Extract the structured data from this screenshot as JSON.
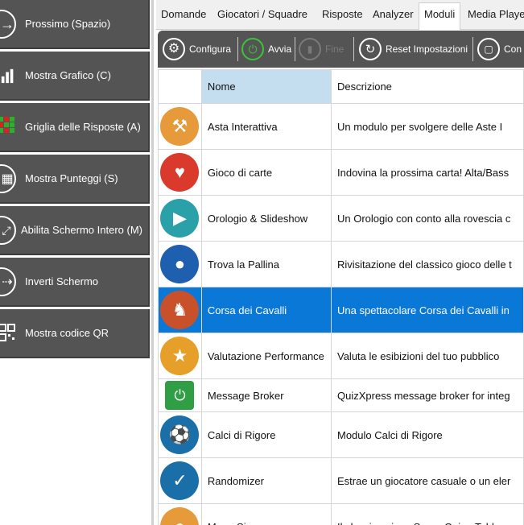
{
  "left_panel": {
    "buttons": [
      {
        "label": "Prossimo (Spazio)",
        "icon": "arrow-right-icon"
      },
      {
        "label": "Mostra Grafico (C)",
        "icon": "bar-chart-icon"
      },
      {
        "label": "Griglia delle Risposte (A)",
        "icon": "answer-grid-icon"
      },
      {
        "label": "Mostra Punteggi (S)",
        "icon": "scores-icon"
      },
      {
        "label": "Abilita Schermo Intero (M)",
        "icon": "fullscreen-icon"
      },
      {
        "label": "Inverti Schermo",
        "icon": "invert-screen-icon"
      },
      {
        "label": "Mostra codice QR",
        "icon": "qr-code-icon"
      }
    ]
  },
  "tabs": [
    {
      "label": "Domande"
    },
    {
      "label": "Giocatori / Squadre"
    },
    {
      "label": "Risposte"
    },
    {
      "label": "Analyzer"
    },
    {
      "label": "Moduli",
      "active": true
    },
    {
      "label": "Media Player"
    }
  ],
  "toolbar": {
    "configura": "Configura",
    "avvia": "Avvia",
    "fine": "Fine",
    "reset": "Reset Impostazioni",
    "con": "Con"
  },
  "table": {
    "columns": [
      "",
      "Nome",
      "Descrizione"
    ],
    "rows": [
      {
        "name": "Asta Interattiva",
        "description": "Un modulo per svolgere  delle Aste I",
        "icon": "auction-icon",
        "color": "#e69a3a"
      },
      {
        "name": "Gioco di carte",
        "description": "Indovina la prossima carta! Alta/Bass",
        "icon": "cards-icon",
        "color": "#d93a2b"
      },
      {
        "name": "Orologio & Slideshow",
        "description": "Un Orologio con conto alla rovescia c",
        "icon": "clock-slideshow-icon",
        "color": "#2aa0a8"
      },
      {
        "name": "Trova la Pallina",
        "description": "Rivisitazione del classico gioco delle t",
        "icon": "ball-icon",
        "color": "#1f5fb0"
      },
      {
        "name": "Corsa dei Cavalli",
        "description": "Una spettacolare Corsa dei Cavalli in",
        "icon": "horse-icon",
        "color": "#c8502a",
        "selected": true
      },
      {
        "name": "Valutazione Performance",
        "description": "Valuta le esibizioni del tuo pubblico",
        "icon": "microphone-icon",
        "color": "#e6a02a"
      },
      {
        "name": "Message Broker",
        "description": "QuizXpress message broker for integ",
        "icon": "message-broker-icon",
        "color": "#2f9e44"
      },
      {
        "name": "Calci di Rigore",
        "description": "Modulo Calci di Rigore",
        "icon": "soccer-ball-icon",
        "color": "#1b6fa8"
      },
      {
        "name": "Randomizer",
        "description": "Estrae un giocatore casuale o un eler",
        "icon": "randomizer-icon",
        "color": "#1b6fa8"
      },
      {
        "name": "Mega Sign",
        "description": "Il classico gioco Super Quiz - Tabl",
        "icon": "partial-icon",
        "color": "#e69a3a"
      }
    ]
  }
}
